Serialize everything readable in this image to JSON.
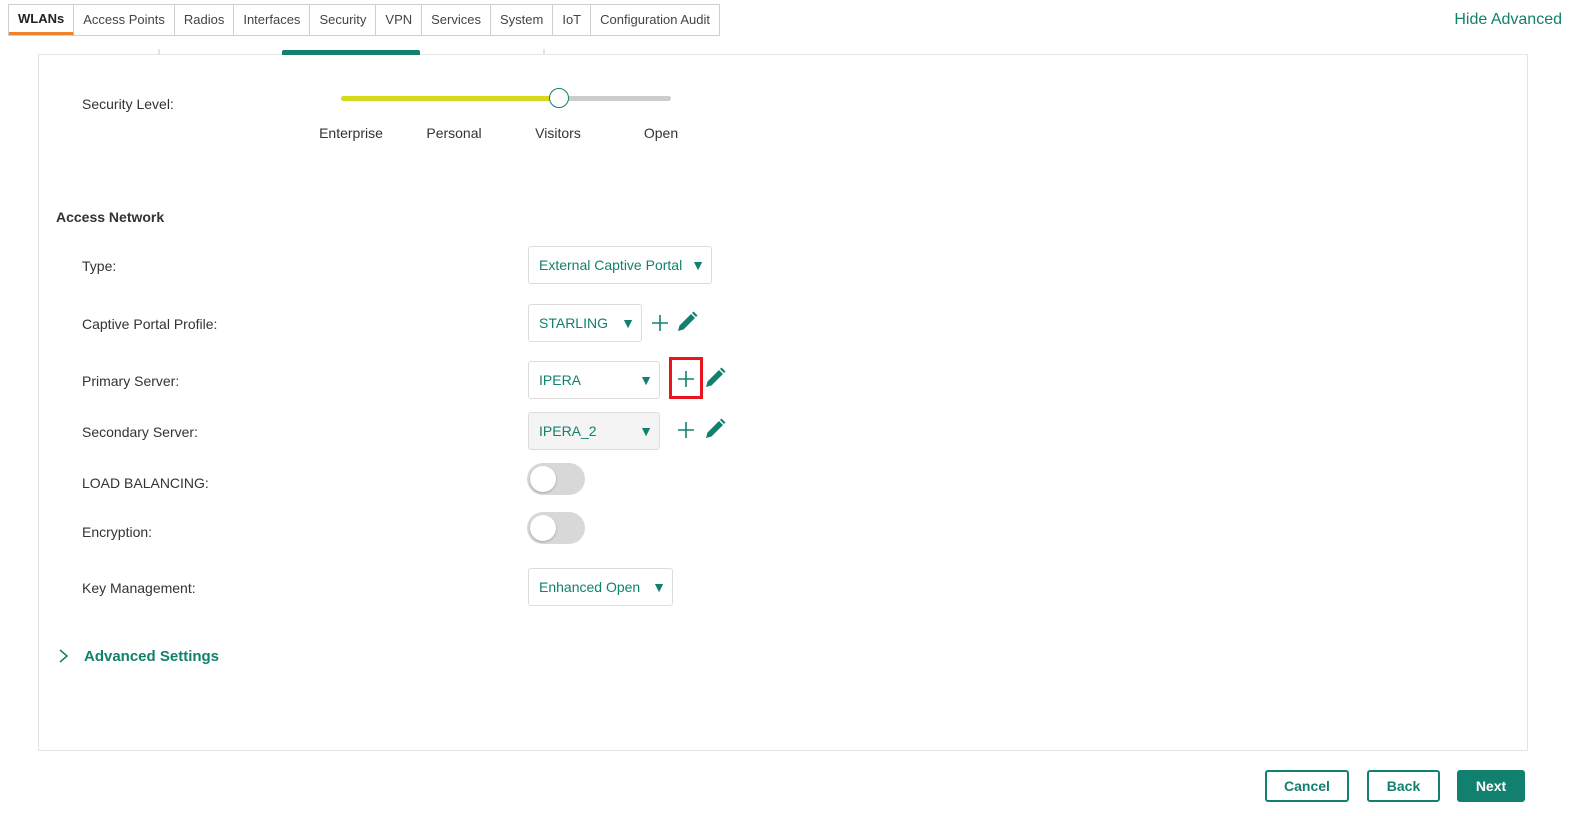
{
  "tabs": [
    {
      "label": "WLANs",
      "active": true
    },
    {
      "label": "Access Points"
    },
    {
      "label": "Radios"
    },
    {
      "label": "Interfaces"
    },
    {
      "label": "Security"
    },
    {
      "label": "VPN"
    },
    {
      "label": "Services"
    },
    {
      "label": "System"
    },
    {
      "label": "IoT"
    },
    {
      "label": "Configuration Audit"
    }
  ],
  "header": {
    "hide_advanced": "Hide Advanced"
  },
  "security": {
    "label": "Security Level:",
    "levels": [
      "Enterprise",
      "Personal",
      "Visitors",
      "Open"
    ],
    "selected_level": "Visitors",
    "selected_fraction": 0.66
  },
  "access_network": {
    "title": "Access Network",
    "type": {
      "label": "Type:",
      "value": "External Captive Portal"
    },
    "captive_portal_profile": {
      "label": "Captive Portal Profile:",
      "value": "STARLING"
    },
    "primary_server": {
      "label": "Primary Server:",
      "value": "IPERA"
    },
    "secondary_server": {
      "label": "Secondary Server:",
      "value": "IPERA_2"
    },
    "load_balancing": {
      "label": "LOAD BALANCING:",
      "on": false
    },
    "encryption": {
      "label": "Encryption:",
      "on": false
    },
    "key_management": {
      "label": "Key Management:",
      "value": "Enhanced Open"
    }
  },
  "advanced_settings": {
    "label": "Advanced Settings"
  },
  "footer": {
    "cancel": "Cancel",
    "back": "Back",
    "next": "Next"
  },
  "colors": {
    "accent": "#12806e",
    "slider_fill": "#d4d91a",
    "active_tab": "#f0822a",
    "highlight": "#e8141e"
  }
}
